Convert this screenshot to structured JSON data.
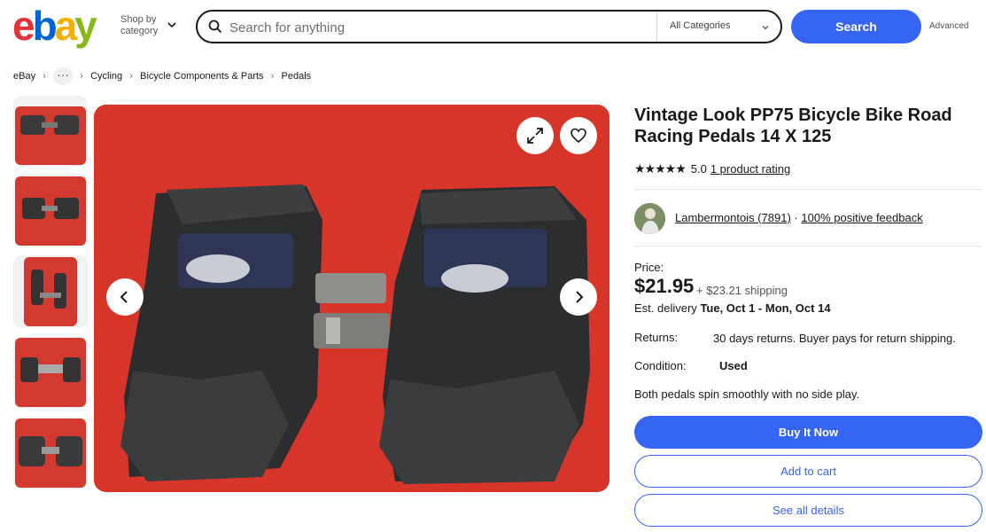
{
  "header": {
    "logo_letters": [
      "e",
      "b",
      "a",
      "y"
    ],
    "logo_colors": [
      "#e53238",
      "#0064d2",
      "#f5af02",
      "#86b817"
    ],
    "shop_by_line1": "Shop by",
    "shop_by_line2": "category",
    "search_placeholder": "Search for anything",
    "category_select": "All Categories",
    "search_button": "Search",
    "advanced_link": "Advanced",
    "accent_color": "#3665f3"
  },
  "breadcrumb": {
    "root": "eBay",
    "more": "···",
    "items": [
      "Cycling",
      "Bicycle Components & Parts",
      "Pedals"
    ]
  },
  "gallery": {
    "thumbnail_count": 5,
    "expand_icon": "expand-icon",
    "favorite_icon": "heart-icon",
    "prev_icon": "chevron-left-icon",
    "next_icon": "chevron-right-icon"
  },
  "listing": {
    "title": "Vintage Look PP75 Bicycle Bike Road Racing Pedals 14 X 125",
    "stars": "★★★★★",
    "rating_value": "5.0",
    "rating_count": "1 product rating",
    "seller_name": "Lambermontois (7891)",
    "seller_sep": "·",
    "seller_feedback": "100% positive feedback",
    "price_label": "Price:",
    "price": "$21.95",
    "shipping": "+ $23.21 shipping",
    "delivery_prefix": "Est. delivery",
    "delivery_dates": "Tue, Oct 1 - Mon, Oct 14",
    "returns_label": "Returns:",
    "returns_value": "30 days returns. Buyer pays for return shipping.",
    "condition_label": "Condition:",
    "condition_value": "Used",
    "description": "Both pedals spin smoothly with no side play."
  },
  "actions": {
    "buy_now": "Buy It Now",
    "add_to_cart": "Add to cart",
    "see_details": "See all details"
  }
}
